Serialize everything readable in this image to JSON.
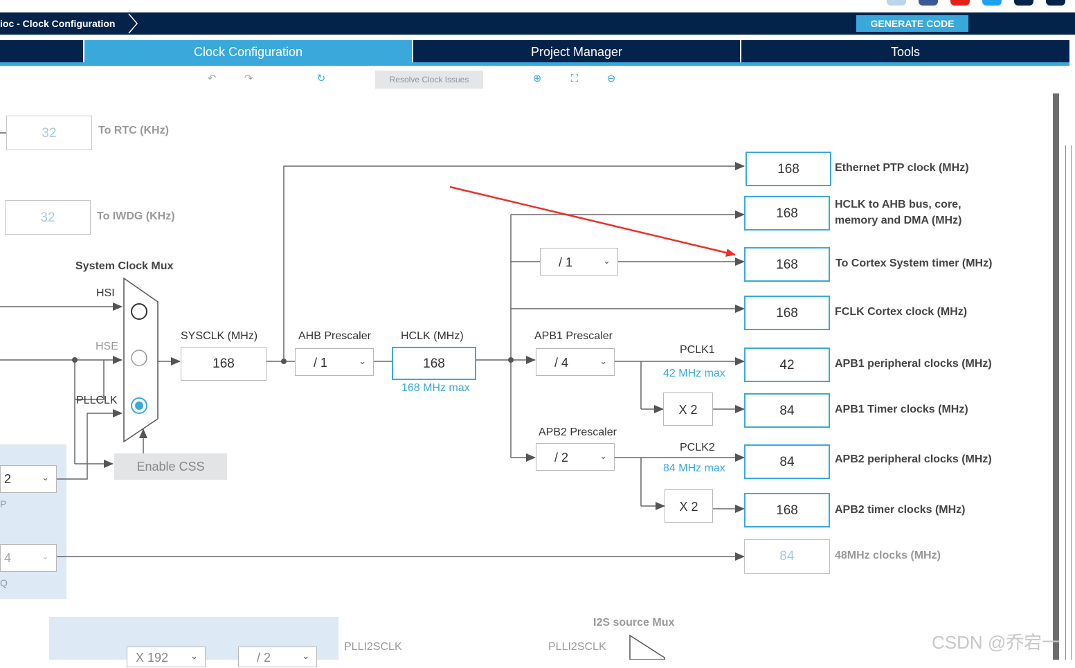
{
  "header": {
    "breadcrumb": "ioc - Clock Configuration",
    "generate_code": "GENERATE CODE"
  },
  "tabs": {
    "clock_configuration": "Clock Configuration",
    "project_manager": "Project Manager",
    "tools": "Tools"
  },
  "toolbar": {
    "resolve": "Resolve Clock Issues",
    "icons": [
      "undo-icon",
      "redo-icon",
      "refresh-icon",
      "zoom-in-icon",
      "fit-icon",
      "zoom-out-icon"
    ]
  },
  "rtc": {
    "value": "32",
    "label": "To RTC (KHz)"
  },
  "iwdg": {
    "value": "32",
    "label": "To IWDG (KHz)"
  },
  "mux": {
    "title": "System Clock Mux",
    "hsi": "HSI",
    "hse": "HSE",
    "pllclk": "PLLCLK",
    "selected": "PLLCLK",
    "enable_css": "Enable CSS"
  },
  "sysclk": {
    "label": "SYSCLK (MHz)",
    "value": "168"
  },
  "ahb": {
    "label": "AHB Prescaler",
    "value": "/ 1"
  },
  "hclk": {
    "label": "HCLK (MHz)",
    "value": "168",
    "max": "168 MHz max"
  },
  "apb1": {
    "label": "APB1 Prescaler",
    "value": "/ 4",
    "pclk": "PCLK1",
    "max": "42 MHz max",
    "x2": "X 2"
  },
  "apb2": {
    "label": "APB2 Prescaler",
    "value": "/ 2",
    "pclk": "PCLK2",
    "max": "84 MHz max",
    "x2": "X 2"
  },
  "cortex_div": "/ 1",
  "outputs": [
    {
      "value": "168",
      "label": "Ethernet PTP clock (MHz)"
    },
    {
      "value": "168",
      "label": "HCLK to AHB bus, core, memory and DMA (MHz)"
    },
    {
      "value": "168",
      "label": "To Cortex System timer (MHz)"
    },
    {
      "value": "168",
      "label": "FCLK Cortex clock (MHz)"
    },
    {
      "value": "42",
      "label": "APB1 peripheral clocks (MHz)"
    },
    {
      "value": "84",
      "label": "APB1 Timer clocks (MHz)"
    },
    {
      "value": "84",
      "label": "APB2 peripheral clocks (MHz)"
    },
    {
      "value": "168",
      "label": "APB2 timer clocks (MHz)"
    },
    {
      "value": "84",
      "label": "48MHz clocks (MHz)"
    }
  ],
  "pll_left": {
    "p_value": "2",
    "q_value": "4",
    "p_label": "P",
    "q_label": "Q"
  },
  "bottom": {
    "plli2sclk_left": "PLLI2SCLK",
    "i2s_mux": "I2S source Mux",
    "plli2sclk_mid": "PLLI2SCLK",
    "n_value": "X 192",
    "r_value": "/ 2"
  },
  "watermark": "CSDN @乔宕一",
  "colors": {
    "navy": "#03234b",
    "accent": "#39a9dc",
    "annotation_arrow": "#e8322a"
  }
}
